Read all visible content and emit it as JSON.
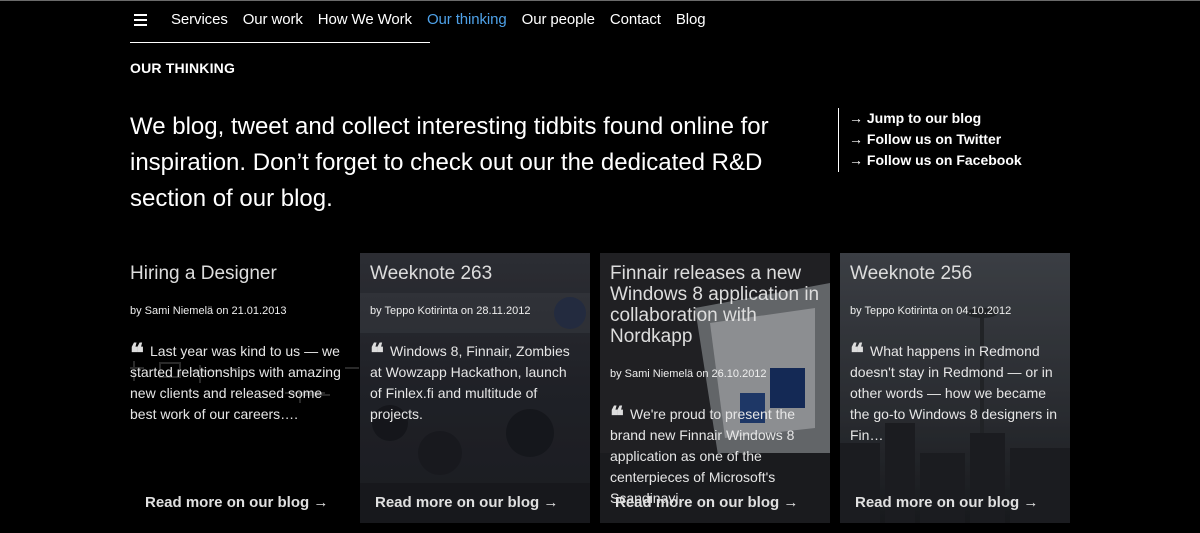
{
  "nav": {
    "items": [
      {
        "label": "Services"
      },
      {
        "label": "Our work"
      },
      {
        "label": "How We Work"
      },
      {
        "label": "Our thinking"
      },
      {
        "label": "Our people"
      },
      {
        "label": "Contact"
      },
      {
        "label": "Blog"
      }
    ],
    "active_color": "#4ea1e8"
  },
  "section_label": "OUR THINKING",
  "intro_text": "We blog, tweet and collect interesting tidbits found online for inspiration. Don’t forget to check out our the dedicated R&D section of our blog.",
  "side_links": [
    {
      "label": "→ Jump to our blog"
    },
    {
      "label": "→ Follow us on Twitter"
    },
    {
      "label": "→ Follow us on Facebook"
    }
  ],
  "cards": [
    {
      "title": "Hiring a Designer",
      "meta": "by Sami Niemelä on 21.01.2013",
      "quote": "Last year was kind to us — we started relationships with amazing new clients and released some best work of our careers….",
      "read_more": "Read more on our blog →"
    },
    {
      "title": "Weeknote 263",
      "meta": "by Teppo Kotirinta on 28.11.2012",
      "quote": "Windows 8, Finnair, Zombies at Wowzapp Hackathon, launch of Finlex.fi and multitude of projects.",
      "read_more": "Read more on our blog →"
    },
    {
      "title": "Finnair releases a new Windows 8 application in collaboration with Nordkapp",
      "meta": "by Sami Niemelä on 26.10.2012",
      "quote": "We're proud to present the brand new Finnair Windows 8 application as one of the centerpieces of Microsoft's Scandinavi…",
      "read_more": "Read more on our blog →"
    },
    {
      "title": "Weeknote 256",
      "meta": "by Teppo Kotirinta on 04.10.2012",
      "quote": "What happens in Redmond doesn't stay in Redmond — or in other words — how we became the go-to Windows 8 designers in Fin…",
      "read_more": "Read more on our blog →"
    }
  ],
  "quote_mark": "❝"
}
